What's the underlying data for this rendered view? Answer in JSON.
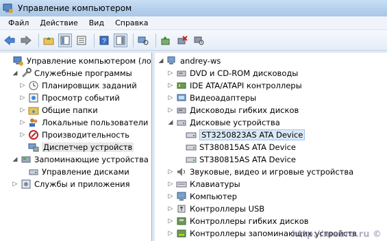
{
  "window": {
    "title": "Управление компьютером"
  },
  "menu": [
    "Файл",
    "Действие",
    "Вид",
    "Справка"
  ],
  "left_tree": [
    {
      "label": "Управление компьютером (локал",
      "level": 0,
      "expander": "",
      "icon": "computer-management-icon"
    },
    {
      "label": "Служебные программы",
      "level": 1,
      "expander": "open",
      "icon": "tools-icon"
    },
    {
      "label": "Планировщик заданий",
      "level": 2,
      "expander": "closed",
      "icon": "clock-icon"
    },
    {
      "label": "Просмотр событий",
      "level": 2,
      "expander": "closed",
      "icon": "event-viewer-icon"
    },
    {
      "label": "Общие папки",
      "level": 2,
      "expander": "closed",
      "icon": "shared-folder-icon"
    },
    {
      "label": "Локальные пользователи и",
      "level": 2,
      "expander": "closed",
      "icon": "users-icon"
    },
    {
      "label": "Производительность",
      "level": 2,
      "expander": "closed",
      "icon": "performance-icon"
    },
    {
      "label": "Диспетчер устройств",
      "level": 2,
      "expander": "",
      "icon": "device-manager-icon",
      "selected": true
    },
    {
      "label": "Запоминающие устройства",
      "level": 1,
      "expander": "open",
      "icon": "storage-icon"
    },
    {
      "label": "Управление дисками",
      "level": 2,
      "expander": "",
      "icon": "disk-management-icon"
    },
    {
      "label": "Службы и приложения",
      "level": 1,
      "expander": "closed",
      "icon": "services-icon"
    }
  ],
  "right_tree": [
    {
      "label": "andrey-ws",
      "level": 0,
      "expander": "open",
      "icon": "computer-icon"
    },
    {
      "label": "DVD и CD-ROM дисководы",
      "level": 1,
      "expander": "closed",
      "icon": "dvd-drive-icon"
    },
    {
      "label": "IDE ATA/ATAPI контроллеры",
      "level": 1,
      "expander": "closed",
      "icon": "ide-controller-icon"
    },
    {
      "label": "Видеоадаптеры",
      "level": 1,
      "expander": "closed",
      "icon": "video-adapter-icon"
    },
    {
      "label": "Дисководы гибких дисков",
      "level": 1,
      "expander": "closed",
      "icon": "floppy-drive-icon"
    },
    {
      "label": "Дисковые устройства",
      "level": 1,
      "expander": "open",
      "icon": "disk-drive-icon"
    },
    {
      "label": "ST3250823AS ATA Device",
      "level": 2,
      "expander": "",
      "icon": "hard-disk-icon",
      "selected": true
    },
    {
      "label": "ST380815AS ATA Device",
      "level": 2,
      "expander": "",
      "icon": "hard-disk-icon"
    },
    {
      "label": "ST380815AS ATA Device",
      "level": 2,
      "expander": "",
      "icon": "hard-disk-icon"
    },
    {
      "label": "Звуковые, видео и игровые устройства",
      "level": 1,
      "expander": "closed",
      "icon": "sound-icon"
    },
    {
      "label": "Клавиатуры",
      "level": 1,
      "expander": "closed",
      "icon": "keyboard-icon"
    },
    {
      "label": "Компьютер",
      "level": 1,
      "expander": "closed",
      "icon": "monitor-icon"
    },
    {
      "label": "Контроллеры USB",
      "level": 1,
      "expander": "closed",
      "icon": "usb-icon"
    },
    {
      "label": "Контроллеры гибких дисков",
      "level": 1,
      "expander": "closed",
      "icon": "floppy-controller-icon"
    },
    {
      "label": "Контроллеры запоминающих устройств",
      "level": 1,
      "expander": "closed",
      "icon": "storage-controller-icon"
    }
  ],
  "watermark": "http://mebro.ru ©",
  "colors": {
    "title_bar": "#b7d1ec",
    "selection": "#dbe9f7",
    "selection_border": "#9ec4ea",
    "pane_bg": "#ffffff"
  }
}
